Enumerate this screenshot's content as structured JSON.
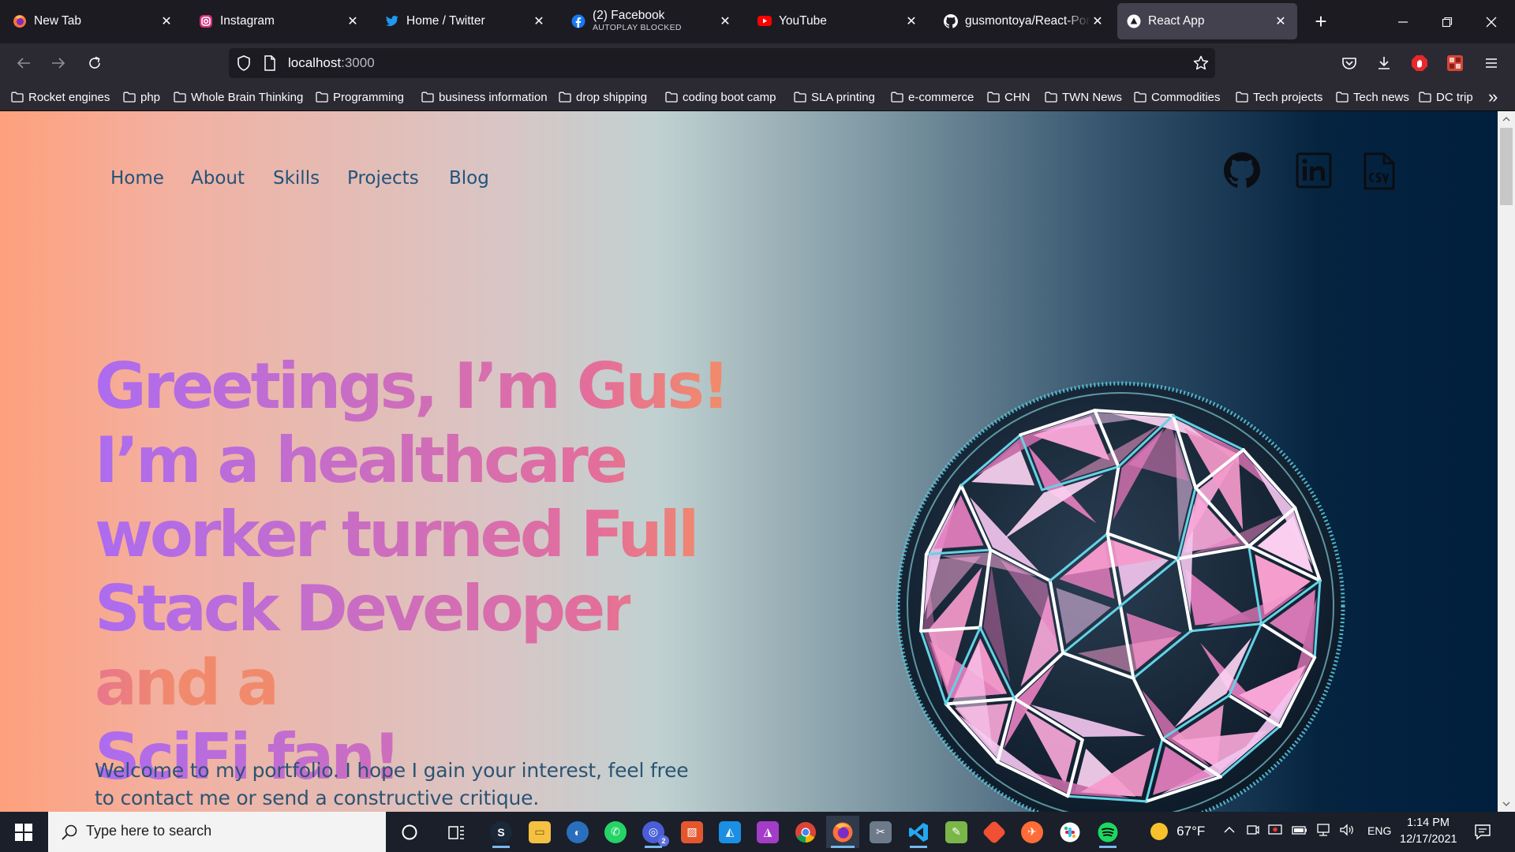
{
  "browser": {
    "tabs": [
      {
        "title": "New Tab",
        "icon": "firefox-icon"
      },
      {
        "title": "Instagram",
        "icon": "instagram-icon"
      },
      {
        "title": "Home / Twitter",
        "icon": "twitter-icon"
      },
      {
        "title": "(2) Facebook",
        "subtitle": "AUTOPLAY BLOCKED",
        "icon": "facebook-icon"
      },
      {
        "title": "YouTube",
        "icon": "youtube-icon"
      },
      {
        "title": "gusmontoya/React-Portfolio",
        "icon": "github-icon"
      },
      {
        "title": "React App",
        "icon": "react-icon",
        "active": true
      }
    ],
    "new_tab_label": "+",
    "url_host": "localhost",
    "url_port": ":3000",
    "bookmarks": [
      "Rocket engines",
      "php",
      "Whole Brain Thinking",
      "Programming",
      "business information",
      "drop shipping",
      "coding boot camp",
      "SLA printing",
      "e-commerce",
      "CHN",
      "TWN News",
      "Commodities",
      "Tech projects",
      "Tech news",
      "DC trip"
    ],
    "bookmarks_overflow": "»"
  },
  "page": {
    "nav": [
      "Home",
      "About",
      "Skills",
      "Projects",
      "Blog"
    ],
    "social": [
      "github-icon",
      "linkedin-icon",
      "csv-file-icon"
    ],
    "hero_lines": [
      "Greetings, I’m Gus!",
      "I’m a healthcare",
      "worker turned Full",
      "Stack Developer and a",
      "SciFi fan!"
    ],
    "welcome": "Welcome to my portfolio. I hope I gain your interest, feel free to contact me or send a constructive critique.",
    "gradient_colors": [
      "#fea07c",
      "#c0d1d1",
      "#001f3e"
    ],
    "hero_colors": [
      "#ac6cf0",
      "#e46e9a",
      "#f18a6c"
    ]
  },
  "taskbar": {
    "search_placeholder": "Type here to search",
    "weather": "67°F",
    "language": "ENG",
    "time": "1:14 PM",
    "date": "12/17/2021",
    "chrome_badge": "2"
  }
}
